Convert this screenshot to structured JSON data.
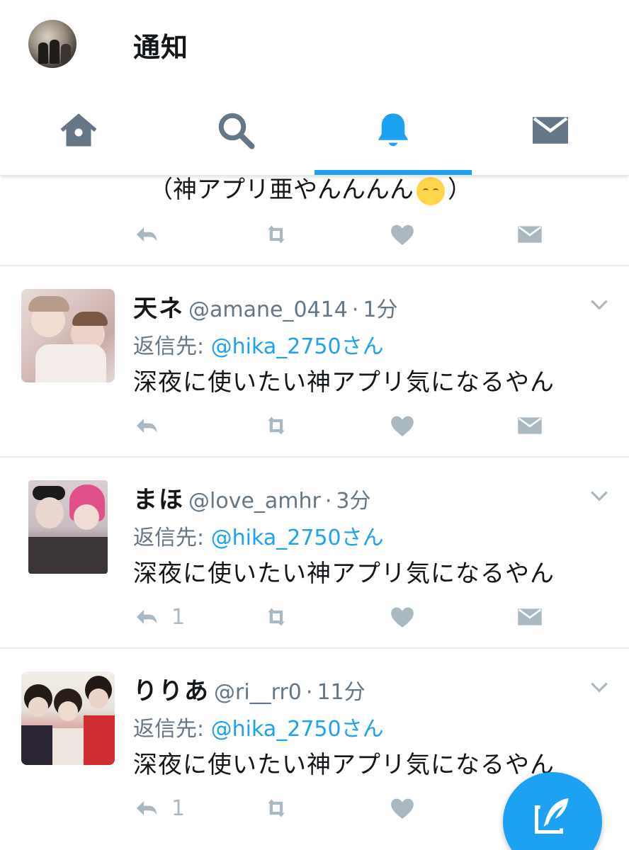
{
  "header": {
    "title": "通知"
  },
  "nav": {
    "tabs": [
      {
        "name": "home",
        "icon": "home-icon"
      },
      {
        "name": "search",
        "icon": "search-icon"
      },
      {
        "name": "notifications",
        "icon": "bell-icon",
        "active": true
      },
      {
        "name": "messages",
        "icon": "envelope-icon"
      }
    ]
  },
  "colors": {
    "accent": "#1da1f2",
    "icon_gray": "#657786",
    "action_gray": "#aab8c2",
    "text": "#14171a",
    "meta": "#657786"
  },
  "partial_tweet": {
    "text_prefix": "（神アプリ亜やんんんん",
    "text_suffix": "）",
    "emoji": "smiling-face-emoji"
  },
  "tweets": [
    {
      "display_name": "天ネ",
      "handle": "@amane_0414",
      "separator": "·",
      "time": "1分",
      "reply_prefix": "返信先: ",
      "reply_to": "@hika_2750さん",
      "text": "深夜に使いたい神アプリ気になるやん",
      "reply_count": ""
    },
    {
      "display_name": "まほ",
      "handle": "@love_amhr",
      "separator": "·",
      "time": "3分",
      "reply_prefix": "返信先: ",
      "reply_to": "@hika_2750さん",
      "text": "深夜に使いたい神アプリ気になるやん",
      "reply_count": "1"
    },
    {
      "display_name": "りりあ",
      "handle": "@ri__rr0",
      "separator": "·",
      "time": "11分",
      "reply_prefix": "返信先: ",
      "reply_to": "@hika_2750さん",
      "text": "深夜に使いたい神アプリ気になるやん",
      "reply_count": "1"
    }
  ],
  "fab": {
    "icon": "compose-tweet-icon"
  }
}
